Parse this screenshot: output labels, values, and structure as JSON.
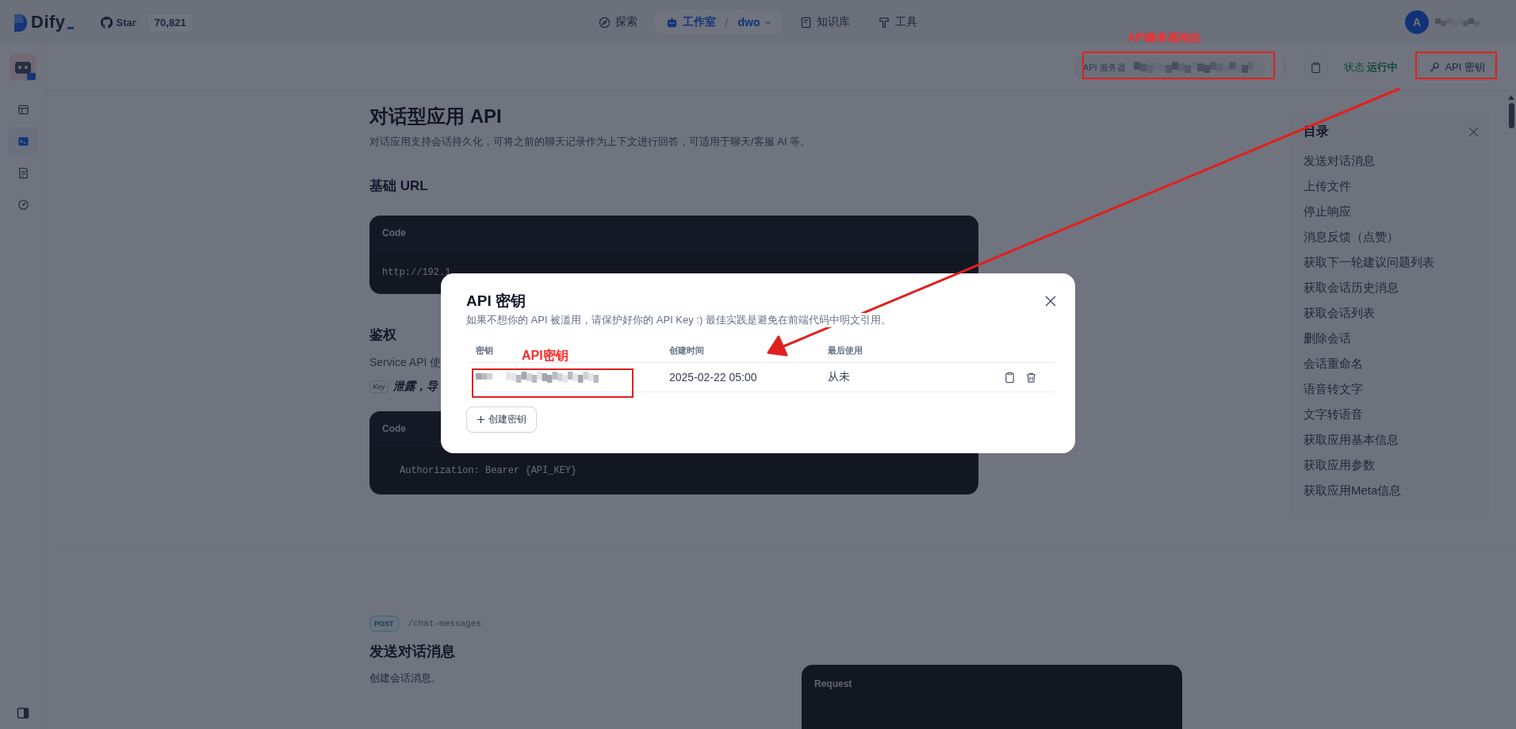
{
  "nav": {
    "logo": "Dify",
    "github_star": "Star",
    "star_count": "70,821",
    "items": [
      {
        "label": "探索",
        "selected": false
      },
      {
        "label": "工作室",
        "selected": true,
        "separator": "/",
        "app": "dwo"
      },
      {
        "label": "知识库",
        "selected": false
      },
      {
        "label": "工具",
        "selected": false
      }
    ],
    "avatar": "A"
  },
  "sidebar": {
    "items": [
      {
        "selected": false
      },
      {
        "selected": true
      },
      {
        "selected": false
      },
      {
        "selected": false
      }
    ]
  },
  "app_header": {
    "server_label": "API 服务器",
    "status_label": "状态",
    "status": "运行中",
    "running": true,
    "api_key_button": "API 密钥"
  },
  "doc": {
    "title": "对话型应用 API",
    "description": "对话应用支持会话持久化，可将之前的聊天记录作为上下文进行回答，可适用于聊天/客服 AI 等。",
    "base_url": {
      "heading": "基础 URL",
      "code_header": "Code",
      "code": "http://192.1"
    },
    "auth": {
      "heading": "鉴权",
      "text": "Service API 使",
      "key_badge": "Key",
      "warning": "泄露，导",
      "code_header": "Code",
      "code": "Authorization: Bearer {API_KEY}"
    },
    "endpoint": {
      "method": "POST",
      "path": "/chat-messages",
      "title": "发送对话消息",
      "description": "创建会话消息。",
      "panel_header": "Request"
    }
  },
  "toc": {
    "title": "目录",
    "items": [
      "发送对话消息",
      "上传文件",
      "停止响应",
      "消息反馈（点赞）",
      "获取下一轮建议问题列表",
      "获取会话历史消息",
      "获取会话列表",
      "删除会话",
      "会话重命名",
      "语音转文字",
      "文字转语音",
      "获取应用基本信息",
      "获取应用参数",
      "获取应用Meta信息"
    ]
  },
  "modal": {
    "title": "API 密钥",
    "description": "如果不想你的 API 被滥用，请保护好你的 API Key :) 最佳实践是避免在前端代码中明文引用。",
    "columns": [
      "密钥",
      "创建时间",
      "最后使用"
    ],
    "rows": [
      {
        "created": "2025-02-22 05:00",
        "last_used": "从未"
      }
    ],
    "create_button": "创建密钥"
  },
  "annotations": {
    "server_label": "API服务器地址",
    "key_label": "API密钥"
  }
}
